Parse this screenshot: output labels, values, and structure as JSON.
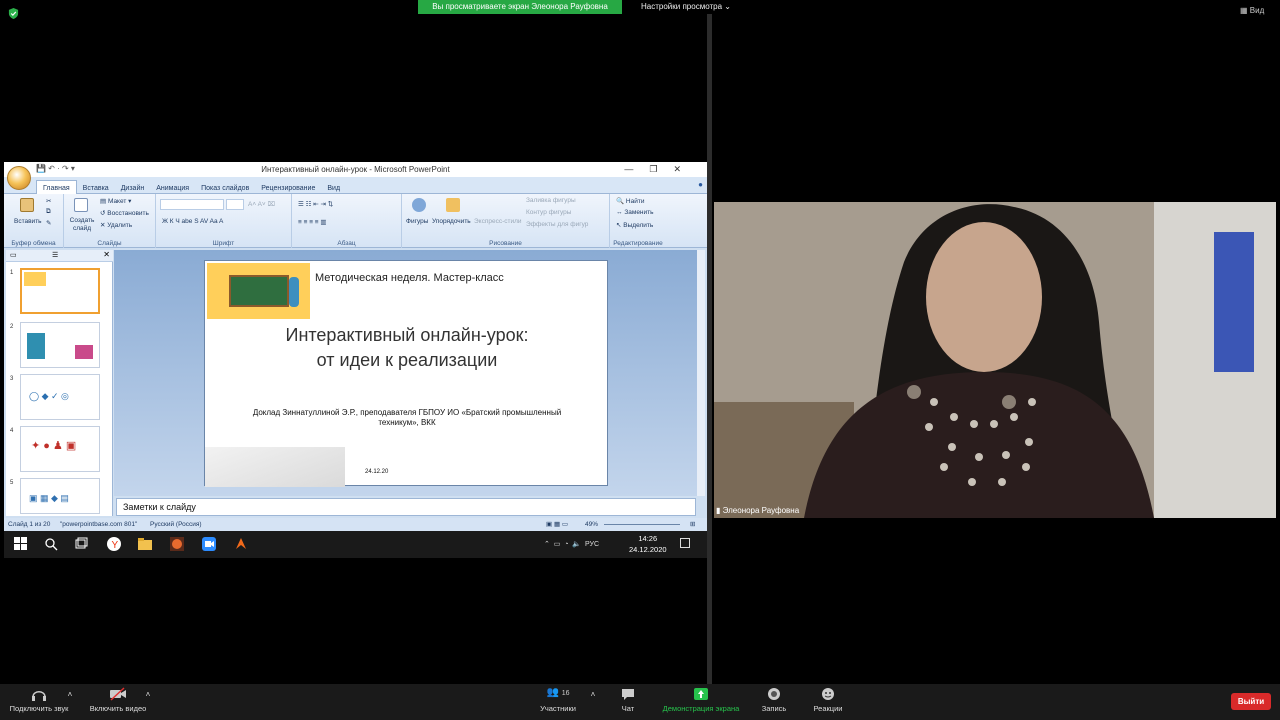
{
  "meeting": {
    "share_banner": "Вы просматриваете экран Элеонора Рауфовна",
    "view_options": "Настройки просмотра",
    "view_button": "Вид",
    "participant_name": "Элеонора Рауфовна",
    "leave_label": "Выйти"
  },
  "powerpoint": {
    "window_title": "Интерактивный онлайн-урок - Microsoft PowerPoint",
    "tabs": [
      "Главная",
      "Вставка",
      "Дизайн",
      "Анимация",
      "Показ слайдов",
      "Рецензирование",
      "Вид"
    ],
    "ribbon": {
      "paste": "Вставить",
      "clipboard_group": "Буфер обмена",
      "layout": "Макет",
      "reset": "Восстановить",
      "delete": "Удалить",
      "new_slide": "Создать слайд",
      "slides_group": "Слайды",
      "font_group": "Шрифт",
      "paragraph_group": "Абзац",
      "shapes": "Фигуры",
      "arrange": "Упорядочить",
      "quick_styles": "Экспресс-стили",
      "shape_fill": "Заливка фигуры",
      "shape_outline": "Контур фигуры",
      "shape_effects": "Эффекты для фигур",
      "drawing_group": "Рисование",
      "find": "Найти",
      "replace": "Заменить",
      "select": "Выделить",
      "editing_group": "Редактирование"
    },
    "thumbnail_numbers": [
      "1",
      "2",
      "3",
      "4",
      "5"
    ],
    "slide": {
      "subtitle": "Методическая неделя. Мастер-класс",
      "title": "Интерактивный онлайн-урок: от идеи к реализации",
      "author": "Доклад Зиннатуллиной Э.Р., преподавателя ГБПОУ ИО «Братский промышленный техникум», ВКК",
      "date": "24.12.20"
    },
    "notes_placeholder": "Заметки к слайду",
    "status": {
      "slide_of": "Слайд 1 из 20",
      "theme": "\"powerpointbase.com 801\"",
      "language": "Русский (Россия)",
      "zoom": "49%"
    }
  },
  "taskbar": {
    "time": "14:26",
    "date": "24.12.2020",
    "lang": "РУС"
  },
  "bottom_bar": {
    "audio": "Подключить звук",
    "video": "Включить видео",
    "participants": "Участники",
    "participants_count": "16",
    "chat": "Чат",
    "share": "Демонстрация экрана",
    "record": "Запись",
    "reactions": "Реакции"
  },
  "colors": {
    "share_green": "#27a844",
    "leave_red": "#d92a2a",
    "ribbon_blue": "#d6e4f5"
  }
}
